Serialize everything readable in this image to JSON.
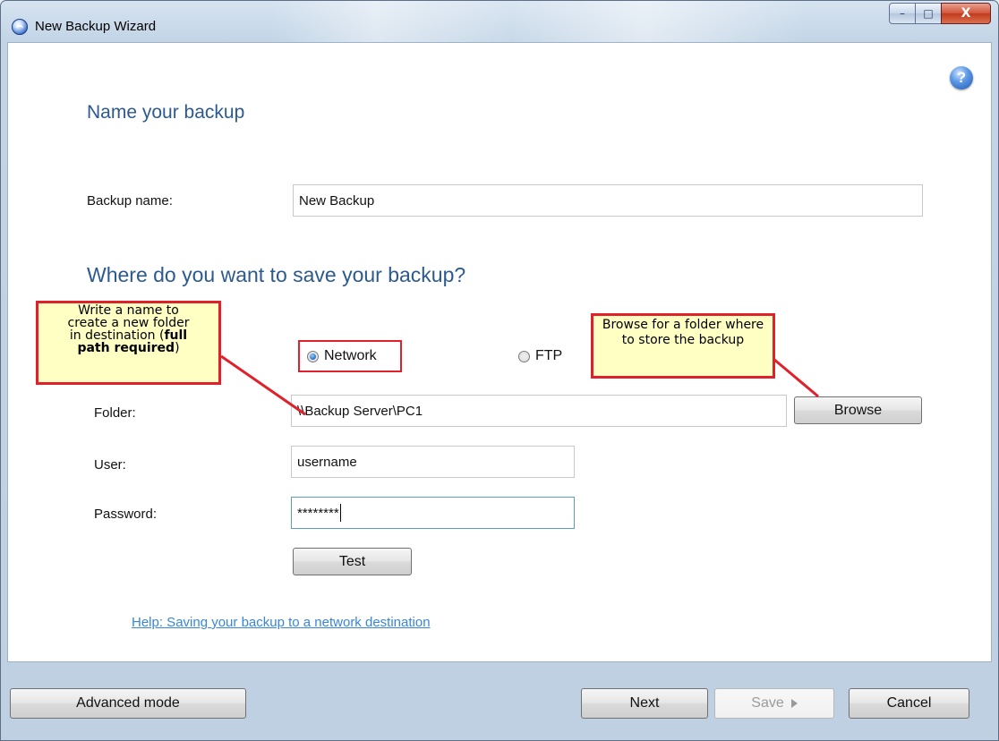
{
  "window": {
    "title": "New Backup Wizard"
  },
  "caption": {
    "minimize": "–",
    "maximize": "□",
    "close": "X"
  },
  "help_icon": "?",
  "section1": {
    "heading": "Name your backup",
    "backup_name_label": "Backup name:",
    "backup_name_value": "New Backup"
  },
  "section2": {
    "heading": "Where do you want to save your backup?"
  },
  "destination": {
    "network_label": "Network",
    "ftp_label": "FTP",
    "selected": "Network"
  },
  "form": {
    "folder_label": "Folder:",
    "folder_value": "\\\\Backup Server\\PC1",
    "user_label": "User:",
    "user_value": "username",
    "password_label": "Password:",
    "password_value": "********",
    "browse_label": "Browse",
    "test_label": "Test"
  },
  "callouts": {
    "folder_line1": "Write a name to",
    "folder_line2": "create a new folder",
    "folder_line3_pre": "in destination (",
    "folder_line3_bold": "full",
    "folder_line4_bold": "path required",
    "folder_line4_post": ")",
    "browse_text": "Browse for a folder where to store the backup"
  },
  "help_link": "Help: Saving your backup to a network destination",
  "footer": {
    "advanced_label": "Advanced mode",
    "next_label": "Next",
    "save_label": "Save",
    "cancel_label": "Cancel"
  }
}
